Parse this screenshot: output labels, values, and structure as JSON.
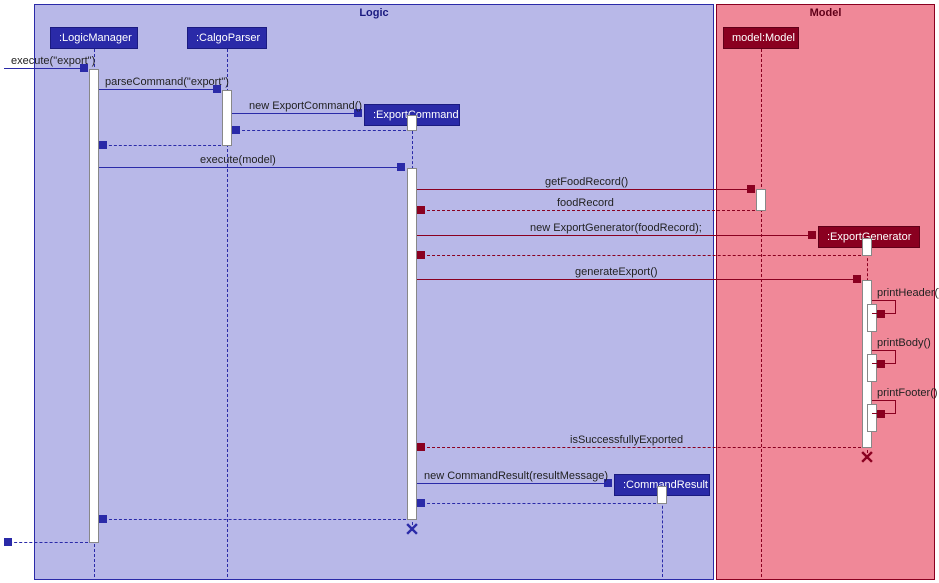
{
  "frames": {
    "logic": {
      "label": "Logic",
      "bg": "#b8b8e8",
      "border": "#2a2aa8"
    },
    "model": {
      "label": "Model",
      "bg": "#f08898",
      "border": "#8a0020"
    }
  },
  "participants": {
    "logicManager": ":LogicManager",
    "calgoParser": ":CalgoParser",
    "exportCommand": ":ExportCommand",
    "commandResult": ":CommandResult",
    "modelModel": "model:Model",
    "exportGenerator": ":ExportGenerator"
  },
  "messages": {
    "m1": "execute(\"export\")",
    "m2": "parseCommand(\"export\")",
    "m3": "new ExportCommand()",
    "m5": "execute(model)",
    "m6": "getFoodRecord()",
    "m7": "foodRecord",
    "m8": "new ExportGenerator(foodRecord);",
    "m9": "generateExport()",
    "m10": "printHeader()",
    "m11": "printBody()",
    "m12": "printFooter()",
    "m13": "isSuccessfullyExported",
    "m14": "new CommandResult(resultMessage)"
  },
  "chart_data": {
    "type": "sequence_diagram",
    "frames": [
      {
        "name": "Logic",
        "participants": [
          "LogicManager",
          "CalgoParser",
          "ExportCommand",
          "CommandResult"
        ]
      },
      {
        "name": "Model",
        "participants": [
          "model:Model",
          "ExportGenerator"
        ]
      }
    ],
    "lifelines": [
      {
        "id": "LogicManager",
        "label": ":LogicManager",
        "frame": "Logic"
      },
      {
        "id": "CalgoParser",
        "label": ":CalgoParser",
        "frame": "Logic"
      },
      {
        "id": "ExportCommand",
        "label": ":ExportCommand",
        "frame": "Logic",
        "created": true,
        "destroyed": true
      },
      {
        "id": "CommandResult",
        "label": ":CommandResult",
        "frame": "Logic",
        "created": true
      },
      {
        "id": "Model",
        "label": "model:Model",
        "frame": "Model"
      },
      {
        "id": "ExportGenerator",
        "label": ":ExportGenerator",
        "frame": "Model",
        "created": true,
        "destroyed": true
      }
    ],
    "messages": [
      {
        "from": "external",
        "to": "LogicManager",
        "label": "execute(\"export\")",
        "type": "sync"
      },
      {
        "from": "LogicManager",
        "to": "CalgoParser",
        "label": "parseCommand(\"export\")",
        "type": "sync"
      },
      {
        "from": "CalgoParser",
        "to": "ExportCommand",
        "label": "new ExportCommand()",
        "type": "create"
      },
      {
        "from": "ExportCommand",
        "to": "CalgoParser",
        "label": "",
        "type": "return"
      },
      {
        "from": "CalgoParser",
        "to": "LogicManager",
        "label": "",
        "type": "return"
      },
      {
        "from": "LogicManager",
        "to": "ExportCommand",
        "label": "execute(model)",
        "type": "sync"
      },
      {
        "from": "ExportCommand",
        "to": "Model",
        "label": "getFoodRecord()",
        "type": "sync"
      },
      {
        "from": "Model",
        "to": "ExportCommand",
        "label": "foodRecord",
        "type": "return"
      },
      {
        "from": "ExportCommand",
        "to": "ExportGenerator",
        "label": "new ExportGenerator(foodRecord);",
        "type": "create"
      },
      {
        "from": "ExportGenerator",
        "to": "ExportCommand",
        "label": "",
        "type": "return"
      },
      {
        "from": "ExportCommand",
        "to": "ExportGenerator",
        "label": "generateExport()",
        "type": "sync"
      },
      {
        "from": "ExportGenerator",
        "to": "ExportGenerator",
        "label": "printHeader()",
        "type": "self"
      },
      {
        "from": "ExportGenerator",
        "to": "ExportGenerator",
        "label": "printBody()",
        "type": "self"
      },
      {
        "from": "ExportGenerator",
        "to": "ExportGenerator",
        "label": "printFooter()",
        "type": "self"
      },
      {
        "from": "ExportGenerator",
        "to": "ExportCommand",
        "label": "isSuccessfullyExported",
        "type": "return"
      },
      {
        "from": "ExportCommand",
        "to": "CommandResult",
        "label": "new CommandResult(resultMessage)",
        "type": "create"
      },
      {
        "from": "CommandResult",
        "to": "ExportCommand",
        "label": "",
        "type": "return"
      },
      {
        "from": "ExportCommand",
        "to": "LogicManager",
        "label": "",
        "type": "return"
      },
      {
        "from": "LogicManager",
        "to": "external",
        "label": "",
        "type": "return"
      }
    ]
  }
}
